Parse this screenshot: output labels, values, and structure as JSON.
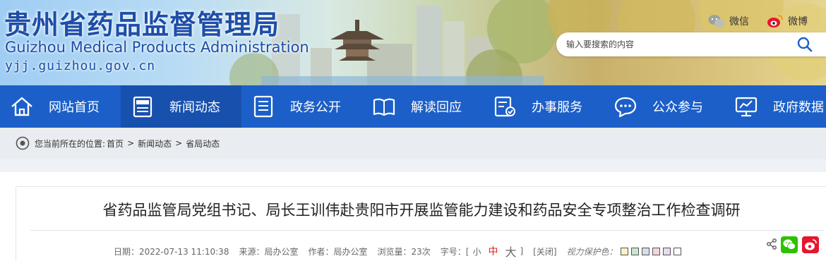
{
  "header": {
    "title": "贵州省药品监督管理局",
    "title_en": "Guizhou Medical Products Administration",
    "domain": "yjj.guizhou.gov.cn",
    "wechat_label": "微信",
    "weibo_label": "微博",
    "search": {
      "placeholder": "输入要搜索的内容",
      "value": ""
    }
  },
  "nav": {
    "items": [
      {
        "label": "网站首页",
        "icon": "home-icon",
        "active": false
      },
      {
        "label": "新闻动态",
        "icon": "news-icon",
        "active": true
      },
      {
        "label": "政务公开",
        "icon": "document-list-icon",
        "active": false
      },
      {
        "label": "解读回应",
        "icon": "open-book-icon",
        "active": false
      },
      {
        "label": "办事服务",
        "icon": "service-form-icon",
        "active": false
      },
      {
        "label": "公众参与",
        "icon": "chat-bubble-icon",
        "active": false
      },
      {
        "label": "政府数据",
        "icon": "monitor-chart-icon",
        "active": false
      }
    ]
  },
  "breadcrumb": {
    "prefix": "您当前所在的位置:",
    "items": [
      "首页",
      "新闻动态",
      "省局动态"
    ],
    "separator": ">"
  },
  "article": {
    "title": "省药品监管局党组书记、局长王训伟赴贵阳市开展监管能力建设和药品安全专项整治工作检查调研",
    "date": "日期：2022-07-13 11:10:38",
    "source": "来源：局办公室",
    "author": "作者：局办公室",
    "views": "浏览量：23次",
    "font_size_label": "字号：[",
    "font_small": "小",
    "font_medium": "中",
    "font_large": "大",
    "font_close_bracket": "]",
    "close_label": "[关闭]",
    "eye_label": "视力保护色：",
    "eye_colors": [
      "#fbf3c4",
      "#c7e6d2",
      "#d5dee9",
      "#f3d4e1",
      "#e6dbef",
      "#ffffff"
    ]
  },
  "colors": {
    "brand_blue": "#1c5fc8",
    "nav_active": "#1850ad",
    "title_blue": "#1d4ea8",
    "font_medium_red": "#dd2222",
    "wechat_green": "#2dc100",
    "weibo_red": "#e6162d"
  }
}
